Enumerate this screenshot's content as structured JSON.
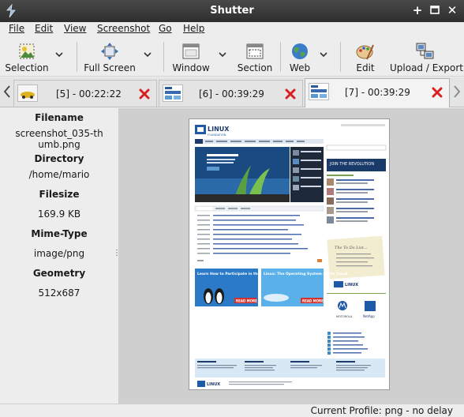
{
  "window": {
    "title": "Shutter"
  },
  "menu": [
    "File",
    "Edit",
    "View",
    "Screenshot",
    "Go",
    "Help"
  ],
  "toolbar": {
    "selection": "Selection",
    "full_screen": "Full Screen",
    "window": "Window",
    "section": "Section",
    "web": "Web",
    "edit": "Edit",
    "upload_export": "Upload / Export"
  },
  "tabs": [
    {
      "label": "[5] - 00:22:22"
    },
    {
      "label": "[6] - 00:39:29"
    },
    {
      "label": "[7] - 00:39:29"
    }
  ],
  "properties": {
    "filename_label": "Filename",
    "filename_line1": "screenshot_035-th",
    "filename_line2": "umb.png",
    "directory_label": "Directory",
    "directory_value": "/home/mario",
    "filesize_label": "Filesize",
    "filesize_value": "169.9 KB",
    "mimetype_label": "Mime-Type",
    "mimetype_value": "image/png",
    "geometry_label": "Geometry",
    "geometry_value": "512x687"
  },
  "preview": {
    "logo_text": "LINUX",
    "logo_sub": "FOUNDATION",
    "promo1": "Learn How to Participate in the Linux Community",
    "promo2": "Linux: The Operating System of the Cloud",
    "read_more": "READ MORE",
    "join_text": "JOIN THE REVOLUTION",
    "todo_text": "The To Do List...",
    "motorola": "MOTOROLA",
    "netapp": "NetApp"
  },
  "status": {
    "text": "Current Profile: png - no delay"
  }
}
